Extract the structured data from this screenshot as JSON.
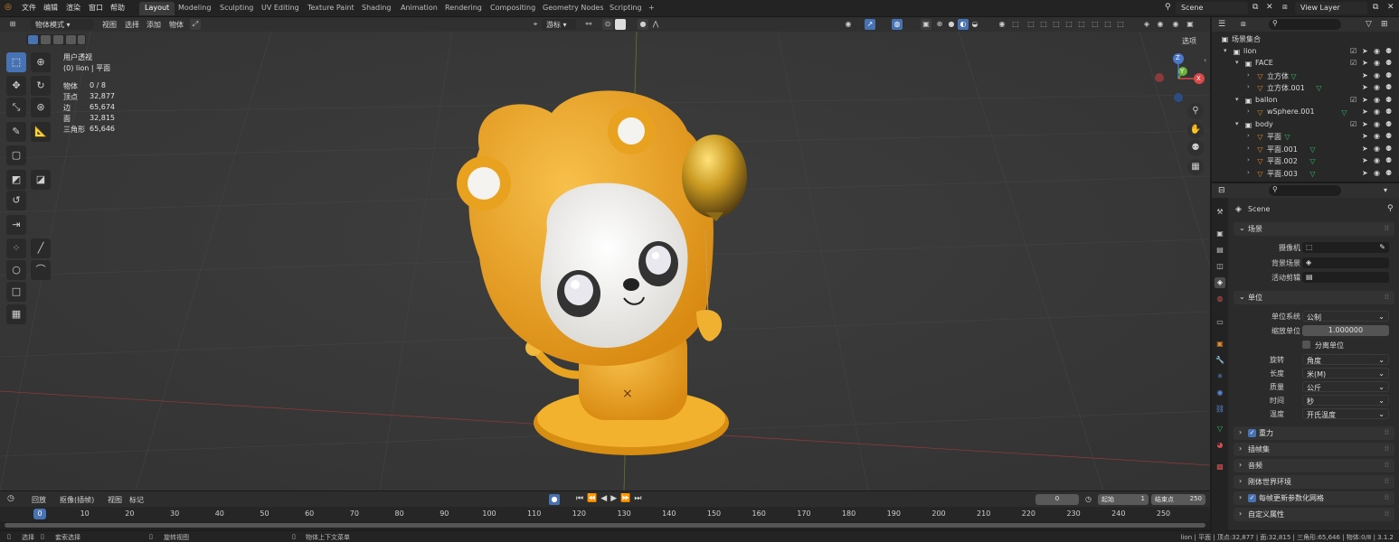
{
  "topbar": {
    "menus": [
      "文件",
      "编辑",
      "渲染",
      "窗口",
      "帮助"
    ],
    "workspaces": [
      "Layout",
      "Modeling",
      "Sculpting",
      "UV Editing",
      "Texture Paint",
      "Shading",
      "Animation",
      "Rendering",
      "Compositing",
      "Geometry Nodes",
      "Scripting"
    ],
    "active_workspace": "Layout",
    "add_tab": "+",
    "scene": "Scene",
    "view_layer": "View Layer"
  },
  "viewport_header": {
    "mode": "物体模式",
    "menus": [
      "视图",
      "选择",
      "添加",
      "物体"
    ],
    "transform": "游标",
    "options": "选项"
  },
  "viewport": {
    "view_name": "用户透视",
    "object_name": "(0) lion | 平面",
    "stats": [
      {
        "label": "物体",
        "value": "0 / 8"
      },
      {
        "label": "顶点",
        "value": "32,877"
      },
      {
        "label": "边",
        "value": "65,674"
      },
      {
        "label": "面",
        "value": "32,815"
      },
      {
        "label": "三角形",
        "value": "65,646"
      }
    ],
    "gizmo": {
      "z": "Z",
      "y": "Y",
      "x": "X"
    },
    "accent_blue": "#4772b3"
  },
  "timeline": {
    "menus": [
      "回放",
      "抠像(插帧)",
      "视图",
      "标记"
    ],
    "current_frame": "0",
    "start_label": "起始",
    "start": "1",
    "end_label": "结束点",
    "end": "250",
    "ticks": [
      "0",
      "10",
      "20",
      "30",
      "40",
      "50",
      "60",
      "70",
      "80",
      "90",
      "100",
      "110",
      "120",
      "130",
      "140",
      "150",
      "160",
      "170",
      "180",
      "190",
      "200",
      "210",
      "220",
      "230",
      "240",
      "250"
    ]
  },
  "statusbar": {
    "select": "选择",
    "box_select": "套索选择",
    "rotate_view": "旋转视图",
    "context_menu": "物体上下文菜单",
    "info": "lion | 平面 | 顶点:32,877 | 面:32,815 | 三角形:65,646 | 物体:0/8 | 3.1.2"
  },
  "outliner": {
    "rows": [
      {
        "label": "场景集合",
        "type": "collection",
        "indent": 0
      },
      {
        "label": "lion",
        "type": "collection",
        "indent": 1
      },
      {
        "label": "FACE",
        "type": "collection",
        "indent": 2
      },
      {
        "label": "立方体",
        "type": "mesh",
        "indent": 3
      },
      {
        "label": "立方体.001",
        "type": "mesh",
        "indent": 3
      },
      {
        "label": "ballon",
        "type": "collection",
        "indent": 2
      },
      {
        "label": "wSphere.001",
        "type": "mesh",
        "indent": 3
      },
      {
        "label": "body",
        "type": "collection",
        "indent": 2
      },
      {
        "label": "平面",
        "type": "mesh",
        "indent": 3
      },
      {
        "label": "平面.001",
        "type": "mesh",
        "indent": 3
      },
      {
        "label": "平面.002",
        "type": "mesh",
        "indent": 3
      },
      {
        "label": "平面.003",
        "type": "mesh",
        "indent": 3
      }
    ]
  },
  "properties": {
    "context": "Scene",
    "scene_panel": {
      "title": "场景",
      "camera_label": "摄像机",
      "background_label": "背景场景",
      "clip_label": "活动剪辑"
    },
    "units_panel": {
      "title": "单位",
      "unit_system_label": "单位系统",
      "unit_system": "公制",
      "scale_label": "缩放单位",
      "scale": "1.000000",
      "separate_label": "分离单位",
      "rotation_label": "旋转",
      "rotation": "角度",
      "length_label": "长度",
      "length": "米(M)",
      "mass_label": "质量",
      "mass": "公斤",
      "time_label": "时间",
      "time": "秒",
      "temperature_label": "温度",
      "temperature": "开氏温度"
    },
    "collapsed_panels": [
      "重力",
      "插帧集",
      "音频",
      "刚体世界环境",
      "每帧更新参数化网格",
      "自定义属性"
    ]
  }
}
